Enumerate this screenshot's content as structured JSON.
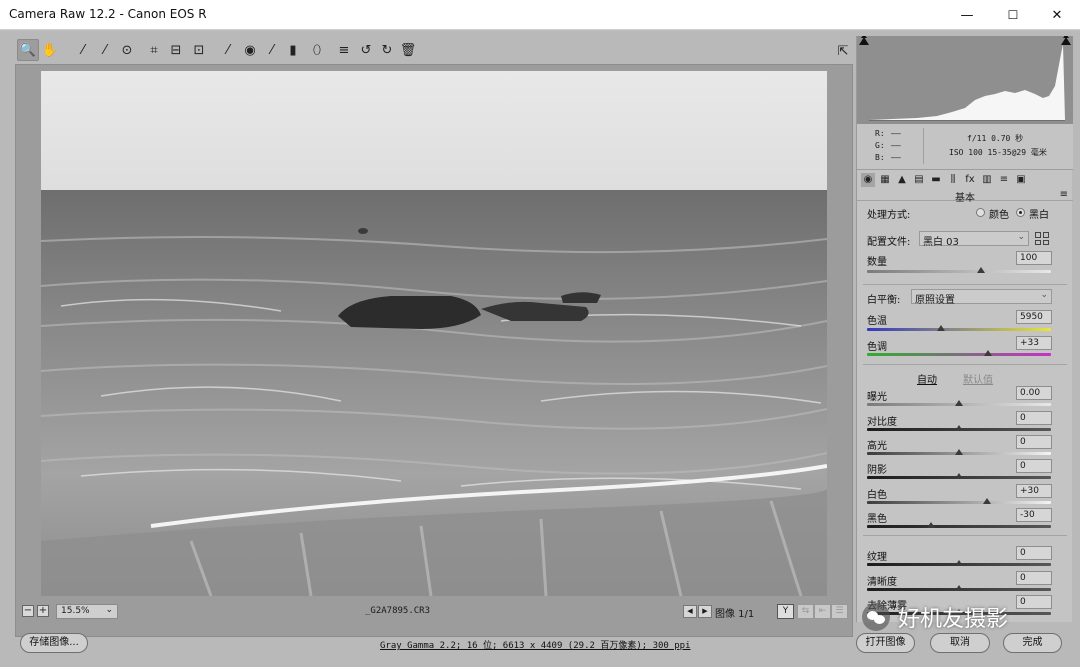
{
  "window": {
    "title": "Camera Raw 12.2 -  Canon EOS R",
    "minimize": "—",
    "maximize": "☐",
    "close": "✕"
  },
  "toolbar": {
    "tools": [
      {
        "name": "zoom-tool-icon",
        "glyph": "🔍"
      },
      {
        "name": "hand-tool-icon",
        "glyph": "✋"
      },
      {
        "name": "white-balance-tool-icon",
        "glyph": "⁄"
      },
      {
        "name": "color-sampler-tool-icon",
        "glyph": "⁄"
      },
      {
        "name": "targeted-adjustment-tool-icon",
        "glyph": "⊙"
      },
      {
        "name": "crop-tool-icon",
        "glyph": "⌗"
      },
      {
        "name": "straighten-tool-icon",
        "glyph": "⊟"
      },
      {
        "name": "transform-tool-icon",
        "glyph": "⊡"
      },
      {
        "name": "spot-removal-tool-icon",
        "glyph": "⁄"
      },
      {
        "name": "red-eye-removal-tool-icon",
        "glyph": "◉"
      },
      {
        "name": "adjustment-brush-icon",
        "glyph": "⁄"
      },
      {
        "name": "graduated-filter-icon",
        "glyph": "▮"
      },
      {
        "name": "radial-filter-icon",
        "glyph": "⬯"
      },
      {
        "name": "preferences-icon",
        "glyph": "≡"
      },
      {
        "name": "rotate-ccw-icon",
        "glyph": "↺"
      },
      {
        "name": "rotate-cw-icon",
        "glyph": "↻"
      },
      {
        "name": "trash-icon",
        "glyph": "🗑"
      }
    ],
    "fullscreen_icon": "⇱"
  },
  "status": {
    "zoom_out": "−",
    "zoom_in": "+",
    "zoom": "15.5%",
    "zoom_caret": "⌄",
    "filename": "_G2A7895.CR3",
    "prev": "◀",
    "next": "▶",
    "image_count": "图像 1/1",
    "y_label": "Y"
  },
  "bottom": {
    "save_label": "存储图像...",
    "workflow": "Gray Gamma 2.2; 16 位; 6613 x 4409 (29.2 百万像素); 300 ppi",
    "open_label": "打开图像",
    "cancel_label": "取消",
    "done_label": "完成"
  },
  "camera_info": {
    "r": "R:",
    "g": "G:",
    "b": "B:",
    "dash": "——",
    "aperture_shutter": "f/11  0.70 秒",
    "iso_lens": "ISO 100  15-35@29 毫米"
  },
  "panel": {
    "section_title": "基本",
    "menu_icon": "≡",
    "treatment_label": "处理方式:",
    "color_label": "颜色",
    "bw_label": "黑白",
    "profile_label": "配置文件:",
    "profile_value": "黑白 03",
    "amount_label": "数量",
    "amount_value": "100",
    "amount_level": 0.62,
    "wb_label": "白平衡:",
    "wb_value": "原照设置",
    "temp_label": "色温",
    "temp_value": "5950",
    "temp_level": 0.4,
    "tint_label": "色调",
    "tint_value": "+33",
    "tint_level": 0.66,
    "auto_label": "自动",
    "default_label": "默认值",
    "sliders": [
      {
        "label": "曝光",
        "value": "0.00",
        "level": 0.5,
        "track": "plain"
      },
      {
        "label": "对比度",
        "value": "0",
        "level": 0.5,
        "track": "dark"
      },
      {
        "label": "高光",
        "value": "0",
        "level": 0.5,
        "track": "lite"
      },
      {
        "label": "阴影",
        "value": "0",
        "level": 0.5,
        "track": "dark"
      },
      {
        "label": "白色",
        "value": "+30",
        "level": 0.65,
        "track": "lite"
      },
      {
        "label": "黑色",
        "value": "-30",
        "level": 0.35,
        "track": "dark"
      },
      {
        "label": "纹理",
        "value": "0",
        "level": 0.5,
        "track": "dark"
      },
      {
        "label": "清晰度",
        "value": "0",
        "level": 0.5,
        "track": "dark"
      },
      {
        "label": "去除薄雾",
        "value": "0",
        "level": 0.5,
        "track": "dark"
      }
    ]
  },
  "watermark": {
    "text": "好机友摄影"
  },
  "colors": {
    "accent_blue": "#3438c0",
    "accent_yellow": "#e9e43c",
    "accent_green": "#2fae2f",
    "accent_magenta": "#c72fc7"
  }
}
